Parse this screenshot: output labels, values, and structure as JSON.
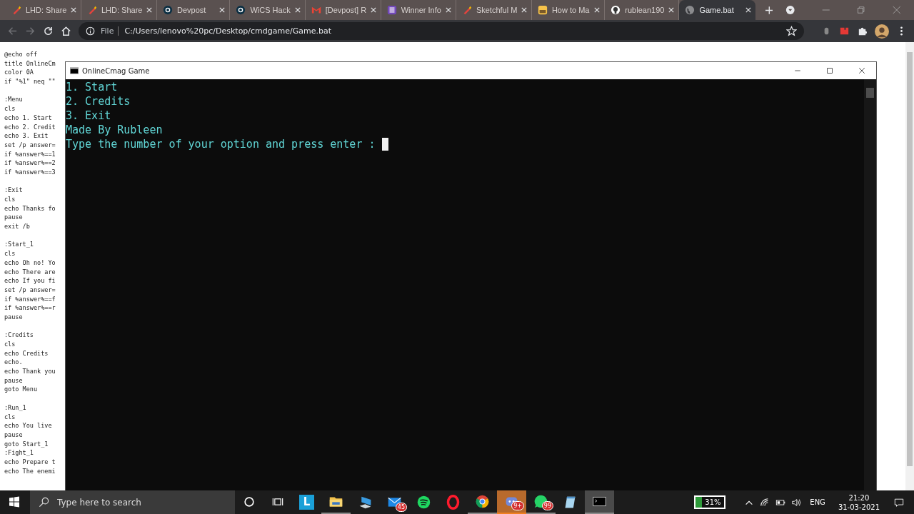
{
  "tabs": [
    {
      "title": "LHD: Share",
      "selected": false
    },
    {
      "title": "LHD: Share",
      "selected": false
    },
    {
      "title": "Devpost",
      "selected": false
    },
    {
      "title": "WiCS Hack",
      "selected": false
    },
    {
      "title": "[Devpost] R",
      "selected": false
    },
    {
      "title": "Winner Info",
      "selected": false
    },
    {
      "title": "Sketchful M",
      "selected": false
    },
    {
      "title": "How to Ma",
      "selected": false
    },
    {
      "title": "rublean190",
      "selected": false
    },
    {
      "title": "Game.bat",
      "selected": true
    }
  ],
  "address": {
    "scheme": "File",
    "url": "C:/Users/lenovo%20pc/Desktop/cmdgame/Game.bat"
  },
  "code_blocks": [
    {
      "lines": [
        "@echo off",
        "title OnlineCm",
        "color 0A",
        "if \"%1\" neq \"\""
      ]
    },
    {
      "lines": [
        ":Menu",
        "cls",
        "echo 1. Start",
        "echo 2. Credit",
        "echo 3. Exit",
        "set /p answer=",
        "if %answer%==1",
        "if %answer%==2",
        "if %answer%==3"
      ]
    },
    {
      "lines": [
        ":Exit",
        "cls",
        "echo Thanks fo",
        "pause",
        "exit /b"
      ]
    },
    {
      "lines": [
        ":Start_1",
        "cls",
        "echo Oh no! Yo",
        "echo There are",
        "echo If you fi",
        "set /p answer=",
        "if %answer%==f",
        "if %answer%==r",
        "pause"
      ]
    },
    {
      "lines": [
        ":Credits",
        "cls",
        "echo Credits",
        "echo.",
        "echo Thank you",
        "pause",
        "goto Menu"
      ]
    },
    {
      "lines": [
        ":Run_1",
        "cls",
        "echo You live",
        "pause",
        "goto Start_1",
        ":Fight_1",
        "echo Prepare t",
        "echo The enemi"
      ]
    }
  ],
  "console": {
    "title": "OnlineCmag Game",
    "lines": [
      "1. Start",
      "2. Credits",
      "3. Exit",
      "Made By Rubleen"
    ],
    "prompt": "Type the number of your option and press enter : "
  },
  "taskbar": {
    "search": {
      "placeholder": "Type here to search"
    },
    "apps": [
      {
        "kind": "launcher",
        "label": "L",
        "running": false,
        "flashing": false,
        "focused": false
      },
      {
        "kind": "folder",
        "running": true,
        "flashing": false,
        "focused": false
      },
      {
        "kind": "computer",
        "running": false,
        "flashing": false,
        "focused": false
      },
      {
        "kind": "mail",
        "badge": "45",
        "running": false,
        "flashing": false,
        "focused": false
      },
      {
        "kind": "spotify",
        "running": false,
        "flashing": false,
        "focused": false
      },
      {
        "kind": "opera",
        "running": false,
        "flashing": false,
        "focused": false
      },
      {
        "kind": "chrome",
        "running": true,
        "flashing": false,
        "focused": false
      },
      {
        "kind": "discord",
        "badge": "9+",
        "running": true,
        "flashing": true,
        "focused": false
      },
      {
        "kind": "whatsapp",
        "badge": "99",
        "running": true,
        "flashing": false,
        "focused": false
      },
      {
        "kind": "notepad",
        "running": false,
        "flashing": false,
        "focused": false
      },
      {
        "kind": "console",
        "running": true,
        "flashing": false,
        "focused": true
      }
    ],
    "battery": "31%",
    "language": "ENG",
    "time": "21:20",
    "date": "31-03-2021"
  }
}
